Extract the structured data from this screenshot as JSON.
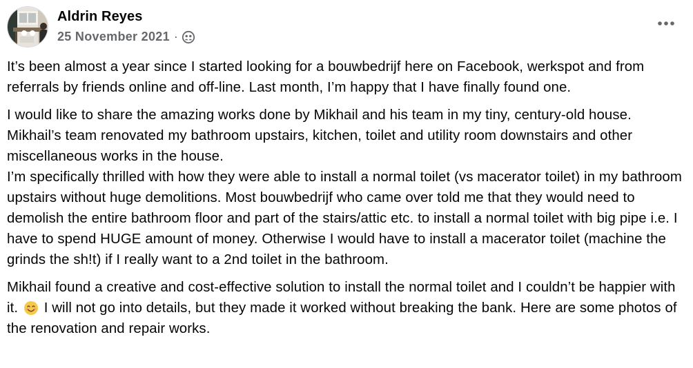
{
  "post": {
    "author": "Aldrin Reyes",
    "date": "25 November 2021",
    "separator": "·",
    "audience_icon": "friends-icon",
    "more_icon": "more-horizontal-icon",
    "paragraphs": [
      "It’s been almost a year since I started looking for a bouwbedrijf here on Facebook, werkspot and from referrals by friends online and off-line. Last month, I’m happy that I have finally found one.",
      "I would like to share the amazing works done by Mikhail and his team in my tiny, century-old house.\nMikhail’s team renovated my bathroom upstairs, kitchen, toilet and utility room downstairs and other miscellaneous works in the house.\nI’m specifically thrilled with how they were able to install a normal toilet (vs macerator toilet) in my bathroom upstairs without huge demolitions. Most bouwbedrijf who came over told me that they would need to demolish the entire bathroom floor and part of the stairs/attic etc. to install a normal toilet with big pipe i.e. I have to spend HUGE amount of money.  Otherwise I would have to install a macerator toilet (machine the grinds the sh!t) if I really want to a 2nd toilet in the bathroom."
    ],
    "last_paragraph_before_emoji": "Mikhail found a creative and cost-effective solution to install the normal toilet and I couldn’t be happier with it.",
    "emoji": "smiling-face-emoji",
    "last_paragraph_after_emoji": "I will not go into details, but they made it worked without breaking the bank.",
    "last_paragraph_cutoff": "Here are some photos of the renovation and repair works."
  }
}
